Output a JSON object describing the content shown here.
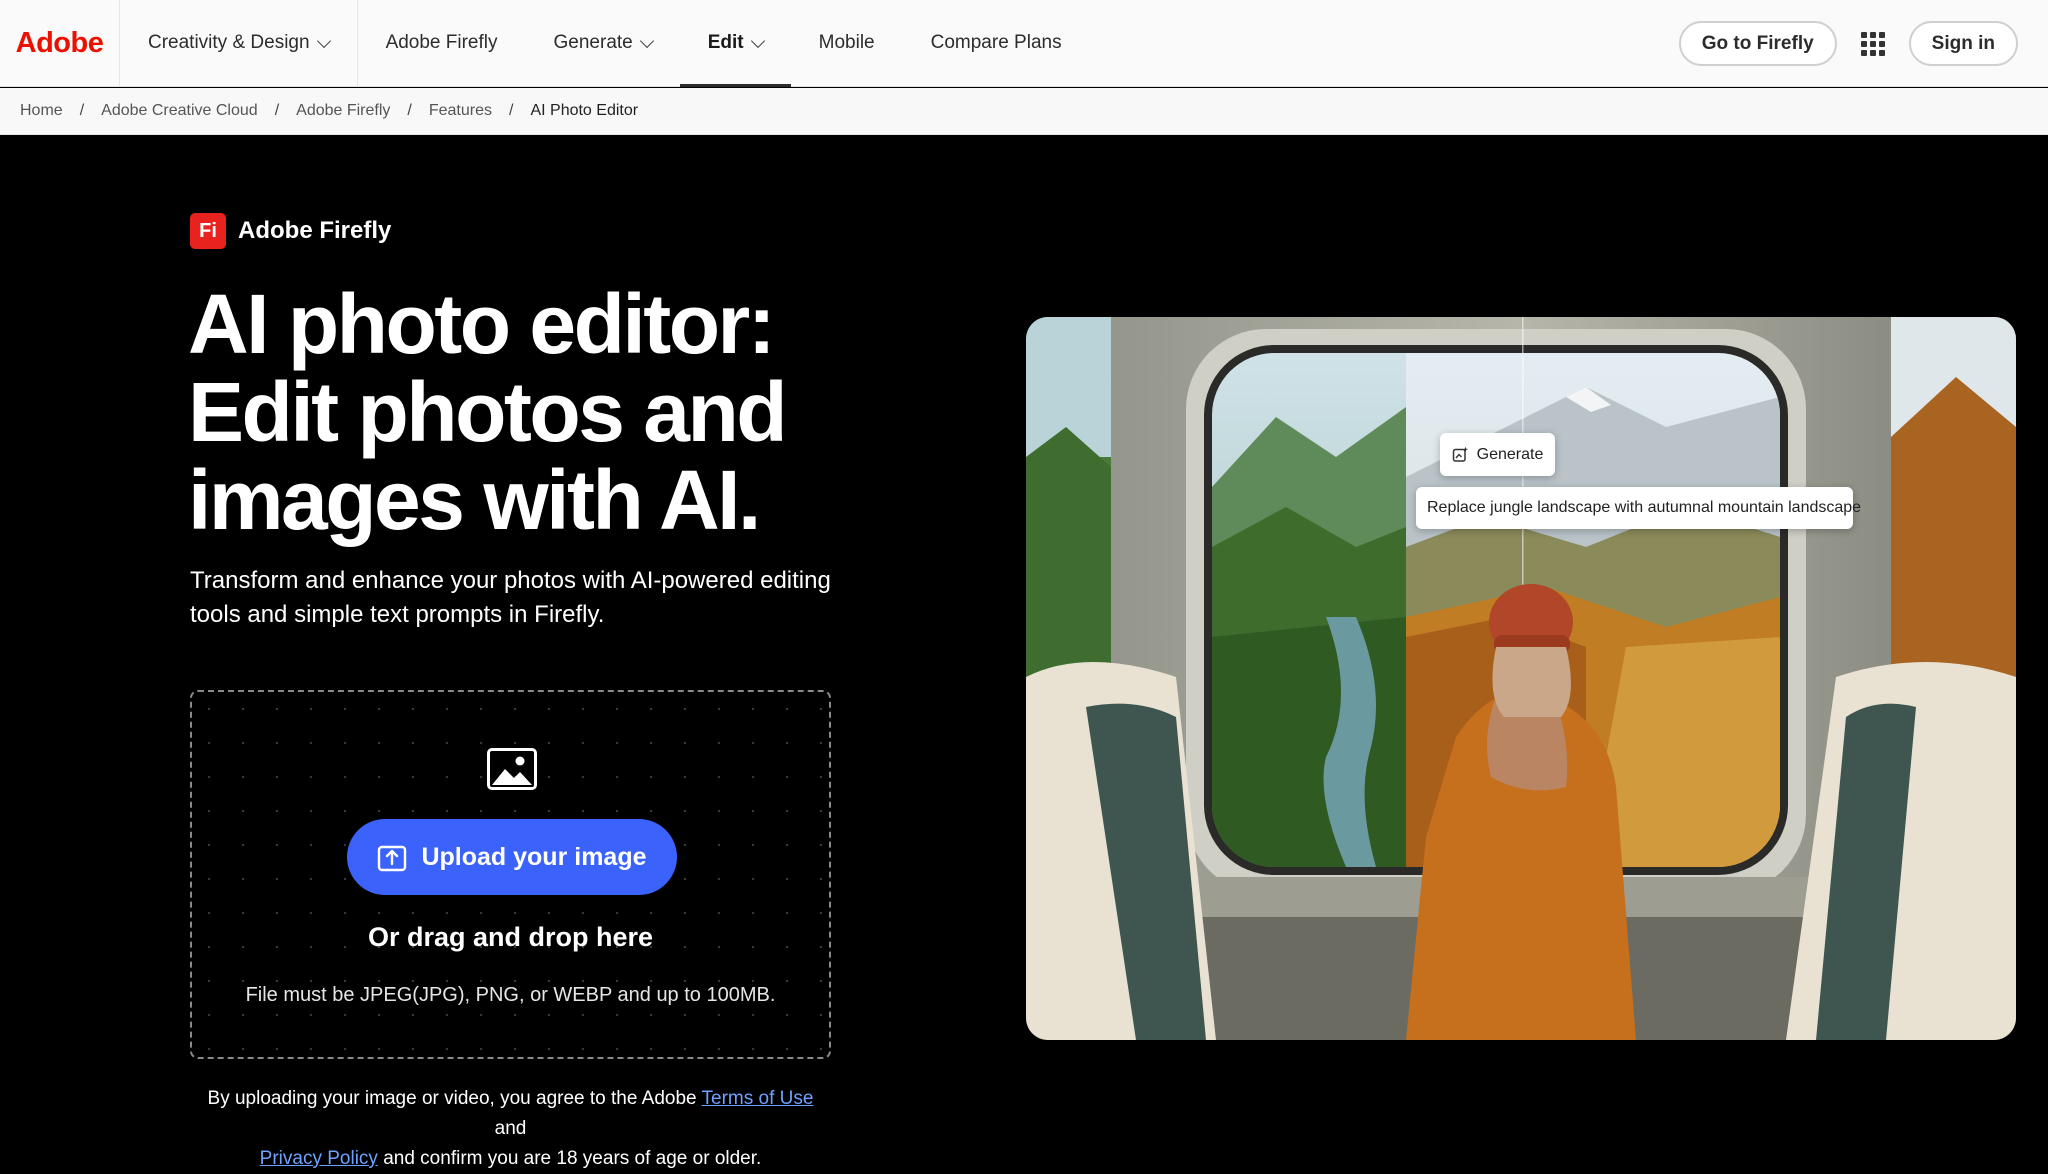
{
  "nav": {
    "logo": "Adobe",
    "items": [
      {
        "label": "Creativity & Design",
        "dropdown": true
      },
      {
        "label": "Adobe Firefly",
        "dropdown": false
      },
      {
        "label": "Generate",
        "dropdown": true
      },
      {
        "label": "Edit",
        "dropdown": true,
        "active": true
      },
      {
        "label": "Mobile",
        "dropdown": false
      },
      {
        "label": "Compare Plans",
        "dropdown": false
      }
    ],
    "go_to_firefly": "Go to Firefly",
    "sign_in": "Sign in"
  },
  "breadcrumb": [
    "Home",
    "Adobe Creative Cloud",
    "Adobe Firefly",
    "Features",
    "AI Photo Editor"
  ],
  "hero": {
    "brand_icon": "Fi",
    "brand_name": "Adobe Firefly",
    "headline": "AI photo editor: Edit photos and images with AI.",
    "subhead": "Transform and enhance your photos with AI-powered editing tools and simple text prompts in Firefly.",
    "upload_label": "Upload your image",
    "drag_text": "Or drag and drop here",
    "file_note": "File must be JPEG(JPG), PNG, or WEBP and up to 100MB.",
    "legal_before": "By uploading your image or video, you agree to the Adobe ",
    "terms_link": "Terms of Use",
    "legal_and": " and",
    "privacy_link": "Privacy Policy",
    "legal_after": " and confirm you are 18 years of age or older."
  },
  "demo": {
    "generate_label": "Generate",
    "prompt_text": "Replace jungle landscape with autumnal mountain landscape"
  },
  "colors": {
    "brand_red": "#eb1000",
    "upload_blue": "#3b63fb",
    "link_blue": "#6fa1ff"
  }
}
